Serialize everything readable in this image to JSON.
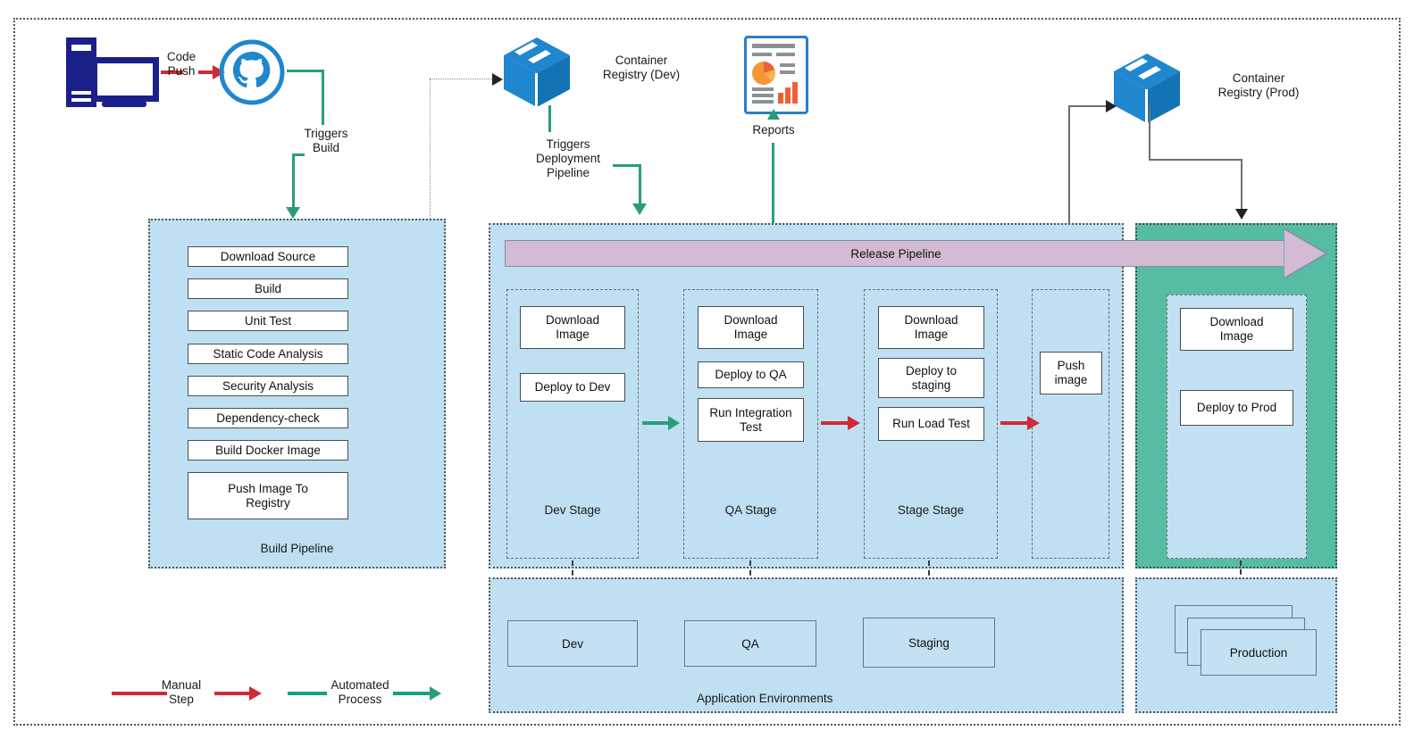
{
  "diagram": {
    "title": "CI/CD Pipeline Diagram",
    "colors": {
      "region_blue": "#bfe0f2",
      "region_prod_teal": "#56bca4",
      "release_band": "#d3bcd3",
      "manual_red": "#d32836",
      "automated_green": "#14a085",
      "icon_blue": "#1f86d0",
      "pc_navy": "#1b1f8a",
      "report_orange": "#ef5f36"
    }
  },
  "source": {
    "pc_icon": "desktop-computer-icon",
    "github_icon": "github-octocat-icon",
    "code_push_label": "Code\nPush",
    "triggers_build_label": "Triggers\nBuild"
  },
  "registries": {
    "dev": {
      "icon": "container-cube-icon",
      "label": "Container\nRegistry (Dev)",
      "trigger_label": "Triggers\nDeployment\nPipeline"
    },
    "prod": {
      "icon": "container-cube-icon",
      "label": "Container\nRegistry (Prod)"
    }
  },
  "reports": {
    "icon": "report-document-icon",
    "label": "Reports"
  },
  "build_pipeline": {
    "label": "Build Pipeline",
    "steps": [
      "Download Source",
      "Build",
      "Unit Test",
      "Static Code Analysis",
      "Security Analysis",
      "Dependency-check",
      "Build Docker Image",
      "Push Image To\nRegistry"
    ]
  },
  "release_pipeline": {
    "band_label": "Release Pipeline",
    "stages": [
      {
        "name": "Dev Stage",
        "steps": [
          "Download\nImage",
          "Deploy to Dev"
        ]
      },
      {
        "name": "QA Stage",
        "steps": [
          "Download\nImage",
          "Deploy to QA",
          "Run Integration\nTest"
        ]
      },
      {
        "name": "Stage Stage",
        "steps": [
          "Download\nImage",
          "Deploy to\nstaging",
          "Run Load Test"
        ]
      },
      {
        "name": "",
        "steps": [
          "Push\nimage"
        ]
      }
    ],
    "prod_stage": {
      "name": "",
      "steps": [
        "Download\nImage",
        "Deploy to Prod"
      ]
    }
  },
  "environments": {
    "label": "Application Environments",
    "items": [
      "Dev",
      "QA",
      "Staging",
      "Production"
    ]
  },
  "legend": {
    "manual": "Manual\nStep",
    "automated": "Automated\nProcess"
  }
}
